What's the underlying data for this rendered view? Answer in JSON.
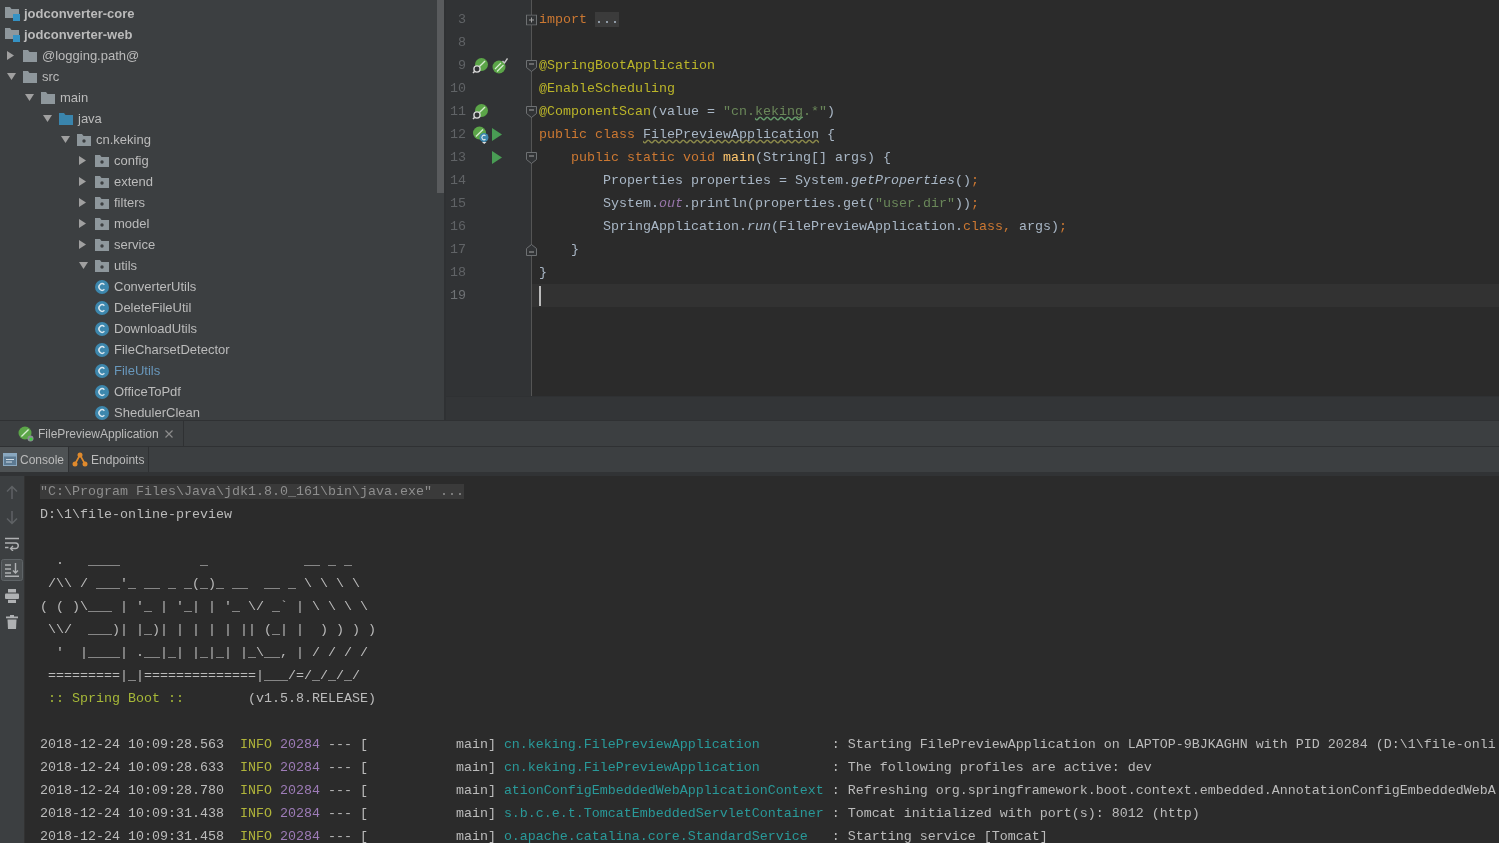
{
  "project_tree": {
    "items": [
      {
        "label": "jodconverter-core",
        "kind": "module"
      },
      {
        "label": "jodconverter-web",
        "kind": "module",
        "children": [
          {
            "label": "@logging.path@",
            "kind": "folder",
            "expanded": false
          },
          {
            "label": "src",
            "kind": "folder",
            "expanded": true,
            "children": [
              {
                "label": "main",
                "kind": "folder",
                "expanded": true,
                "children": [
                  {
                    "label": "java",
                    "kind": "source-root",
                    "expanded": true,
                    "children": [
                      {
                        "label": "cn.keking",
                        "kind": "package",
                        "expanded": true,
                        "children": [
                          {
                            "label": "config",
                            "kind": "package",
                            "expanded": false
                          },
                          {
                            "label": "extend",
                            "kind": "package",
                            "expanded": false
                          },
                          {
                            "label": "filters",
                            "kind": "package",
                            "expanded": false
                          },
                          {
                            "label": "model",
                            "kind": "package",
                            "expanded": false
                          },
                          {
                            "label": "service",
                            "kind": "package",
                            "expanded": false
                          },
                          {
                            "label": "utils",
                            "kind": "package",
                            "expanded": true,
                            "children": [
                              {
                                "label": "ConverterUtils",
                                "kind": "class",
                                "modified": false
                              },
                              {
                                "label": "DeleteFileUtil",
                                "kind": "class",
                                "modified": false
                              },
                              {
                                "label": "DownloadUtils",
                                "kind": "class",
                                "modified": false
                              },
                              {
                                "label": "FileCharsetDetector",
                                "kind": "class",
                                "modified": false
                              },
                              {
                                "label": "FileUtils",
                                "kind": "class",
                                "modified": true
                              },
                              {
                                "label": "OfficeToPdf",
                                "kind": "class",
                                "modified": false
                              },
                              {
                                "label": "ShedulerClean",
                                "kind": "class",
                                "modified": false
                              }
                            ]
                          }
                        ]
                      }
                    ]
                  }
                ]
              }
            ]
          }
        ]
      }
    ]
  },
  "editor": {
    "lines": [
      {
        "number": "3",
        "current": false,
        "fold_marker": {
          "kind": "collapsed"
        },
        "tokens": [
          {
            "kind": "keyword",
            "text": "import "
          },
          {
            "kind": "folded",
            "text": "..."
          }
        ]
      },
      {
        "number": "8",
        "current": false
      },
      {
        "number": "9",
        "current": false,
        "fold_marker": {
          "kind": "start"
        },
        "gutter_icons": [
          {
            "kind": "related"
          },
          {
            "kind": "spring-boot"
          }
        ],
        "tokens": [
          {
            "kind": "annotation",
            "text": "@SpringBootApplication"
          }
        ]
      },
      {
        "number": "10",
        "current": false,
        "tokens": [
          {
            "kind": "annotation",
            "text": "@EnableScheduling"
          }
        ]
      },
      {
        "number": "11",
        "current": false,
        "fold_marker": {
          "kind": "start"
        },
        "gutter_icons": [
          {
            "kind": "related"
          }
        ],
        "tokens": [
          {
            "kind": "annotation",
            "text": "@ComponentScan"
          },
          {
            "kind": "plain",
            "text": "(value = "
          },
          {
            "kind": "string",
            "text": "\"cn."
          },
          {
            "kind": "string-typo",
            "text": "keking"
          },
          {
            "kind": "string",
            "text": ".*\""
          },
          {
            "kind": "plain",
            "text": ")"
          }
        ]
      },
      {
        "number": "12",
        "current": false,
        "gutter_icons": [
          {
            "kind": "bean-class"
          },
          {
            "kind": "run"
          }
        ],
        "tokens": [
          {
            "kind": "keyword",
            "text": "public class "
          },
          {
            "kind": "plain-typo",
            "text": "FilePreviewApplication"
          },
          {
            "kind": "plain",
            "text": " {"
          }
        ]
      },
      {
        "number": "13",
        "current": false,
        "fold_marker": {
          "kind": "start"
        },
        "gutter_icons": [
          {
            "kind": "run"
          }
        ],
        "tokens": [
          {
            "kind": "keyword",
            "text": "    public static void "
          },
          {
            "kind": "method",
            "text": "main"
          },
          {
            "kind": "plain",
            "text": "(String[] args) {"
          }
        ]
      },
      {
        "number": "14",
        "current": false,
        "tokens": [
          {
            "kind": "plain",
            "text": "        Properties properties = System."
          },
          {
            "kind": "static-method",
            "text": "getProperties"
          },
          {
            "kind": "plain",
            "text": "()"
          },
          {
            "kind": "keyword",
            "text": ";"
          }
        ]
      },
      {
        "number": "15",
        "current": false,
        "tokens": [
          {
            "kind": "plain",
            "text": "        System."
          },
          {
            "kind": "static-field",
            "text": "out"
          },
          {
            "kind": "plain",
            "text": ".println(properties.get("
          },
          {
            "kind": "string",
            "text": "\"user.dir\""
          },
          {
            "kind": "plain",
            "text": "))"
          },
          {
            "kind": "keyword",
            "text": ";"
          }
        ]
      },
      {
        "number": "16",
        "current": false,
        "tokens": [
          {
            "kind": "plain",
            "text": "        SpringApplication."
          },
          {
            "kind": "static-method",
            "text": "run"
          },
          {
            "kind": "plain",
            "text": "(FilePreviewApplication."
          },
          {
            "kind": "keyword",
            "text": "class"
          },
          {
            "kind": "keyword",
            "text": ","
          },
          {
            "kind": "plain",
            "text": " args)"
          },
          {
            "kind": "keyword",
            "text": ";"
          }
        ]
      },
      {
        "number": "17",
        "current": false,
        "fold_marker": {
          "kind": "end"
        },
        "tokens": [
          {
            "kind": "plain",
            "text": "    }"
          }
        ]
      },
      {
        "number": "18",
        "current": false,
        "tokens": [
          {
            "kind": "plain",
            "text": "}"
          }
        ]
      },
      {
        "number": "19",
        "current": true
      }
    ]
  },
  "run_window": {
    "tabs": [
      {
        "label": "FilePreviewApplication",
        "selected": true
      }
    ],
    "tool_tabs": [
      {
        "kind": "console",
        "label": "Console",
        "selected": true
      },
      {
        "kind": "endpoints",
        "label": "Endpoints",
        "selected": false
      }
    ],
    "console_toolbar": [
      {
        "kind": "up",
        "disabled": true
      },
      {
        "kind": "down",
        "disabled": true
      },
      {
        "kind": "soft-wrap",
        "disabled": false,
        "on": false
      },
      {
        "kind": "scroll-to-end",
        "disabled": false,
        "on": true
      },
      {
        "kind": "print",
        "disabled": false
      },
      {
        "kind": "clear",
        "disabled": false
      }
    ],
    "console": [
      {
        "kind": "command",
        "text": "\"C:\\Program Files\\Java\\jdk1.8.0_161\\bin\\java.exe\" ..."
      },
      {
        "kind": "plain",
        "text": "D:\\1\\file-online-preview"
      },
      {
        "kind": "blank"
      },
      {
        "kind": "art",
        "text": "  .   ____          _            __ _ _"
      },
      {
        "kind": "art",
        "text": " /\\\\ / ___'_ __ _ _(_)_ __  __ _ \\ \\ \\ \\"
      },
      {
        "kind": "art",
        "text": "( ( )\\___ | '_ | '_| | '_ \\/ _` | \\ \\ \\ \\"
      },
      {
        "kind": "art",
        "text": " \\\\/  ___)| |_)| | | | | || (_| |  ) ) ) )"
      },
      {
        "kind": "art",
        "text": "  '  |____| .__|_| |_|_| |_\\__, | / / / /"
      },
      {
        "kind": "art",
        "text": " =========|_|==============|___/=/_/_/_/"
      },
      {
        "kind": "banner",
        "label": ":: Spring Boot ::",
        "version": "(v1.5.8.RELEASE)"
      },
      {
        "kind": "blank"
      },
      {
        "kind": "log",
        "time": "2018-12-24 10:09:28.563",
        "level": "INFO",
        "pid": "20284",
        "separator": "--- [",
        "thread": "main]",
        "logger": "cn.keking.FilePreviewApplication",
        "message": ": Starting FilePreviewApplication on LAPTOP-9BJKAGHN with PID 20284 (D:\\1\\file-onli"
      },
      {
        "kind": "log",
        "time": "2018-12-24 10:09:28.633",
        "level": "INFO",
        "pid": "20284",
        "separator": "--- [",
        "thread": "main]",
        "logger": "cn.keking.FilePreviewApplication",
        "message": ": The following profiles are active: dev"
      },
      {
        "kind": "log",
        "time": "2018-12-24 10:09:28.780",
        "level": "INFO",
        "pid": "20284",
        "separator": "--- [",
        "thread": "main]",
        "logger": "ationConfigEmbeddedWebApplicationContext",
        "message": ": Refreshing org.springframework.boot.context.embedded.AnnotationConfigEmbeddedWebA"
      },
      {
        "kind": "log",
        "time": "2018-12-24 10:09:31.438",
        "level": "INFO",
        "pid": "20284",
        "separator": "--- [",
        "thread": "main]",
        "logger": "s.b.c.e.t.TomcatEmbeddedServletContainer",
        "message": ": Tomcat initialized with port(s): 8012 (http)"
      },
      {
        "kind": "log",
        "time": "2018-12-24 10:09:31.458",
        "level": "INFO",
        "pid": "20284",
        "separator": "--- [",
        "thread": "main]",
        "logger": "o.apache.catalina.core.StandardService",
        "message": ": Starting service [Tomcat]"
      }
    ]
  }
}
